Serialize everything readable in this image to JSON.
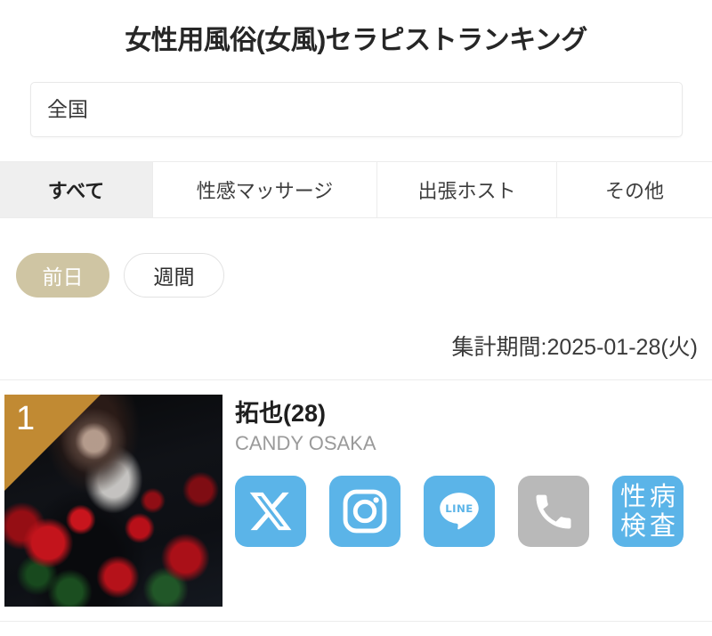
{
  "header": {
    "title": "女性用風俗(女風)セラピストランキング"
  },
  "region_select": {
    "name": "region-select",
    "value": "全国",
    "placeholder": "全国"
  },
  "category_tabs": [
    {
      "label": "すべて",
      "active": true
    },
    {
      "label": "性感マッサージ",
      "active": false
    },
    {
      "label": "出張ホスト",
      "active": false
    },
    {
      "label": "その他",
      "active": false
    }
  ],
  "period_pills": [
    {
      "label": "前日",
      "selected": true
    },
    {
      "label": "週間",
      "selected": false
    }
  ],
  "aggregate_period": {
    "label": "集計期間:2025-01-28(火)"
  },
  "ranking": [
    {
      "rank": "1",
      "name": "拓也(28)",
      "shop": "CANDY OSAKA",
      "links": [
        {
          "icon": "x-twitter-icon",
          "label": "X",
          "state": "active"
        },
        {
          "icon": "instagram-icon",
          "label": "Instagram",
          "state": "active"
        },
        {
          "icon": "line-icon",
          "label": "LINE",
          "state": "active"
        },
        {
          "icon": "phone-icon",
          "label": "電話",
          "state": "disabled"
        },
        {
          "icon": "std-test-icon",
          "label": "性病検査",
          "state": "active"
        }
      ],
      "std_badge": {
        "line1_char1": "性",
        "line1_char2": "病",
        "line2_char1": "検",
        "line2_char2": "査"
      }
    }
  ],
  "colors": {
    "accent_gold": "#c18a33",
    "pill_selected": "#cfc5a3",
    "icon_blue": "#5bb4e8",
    "icon_gray": "#b9b9b9",
    "tab_active_bg": "#efefef",
    "divider": "#ececec"
  }
}
